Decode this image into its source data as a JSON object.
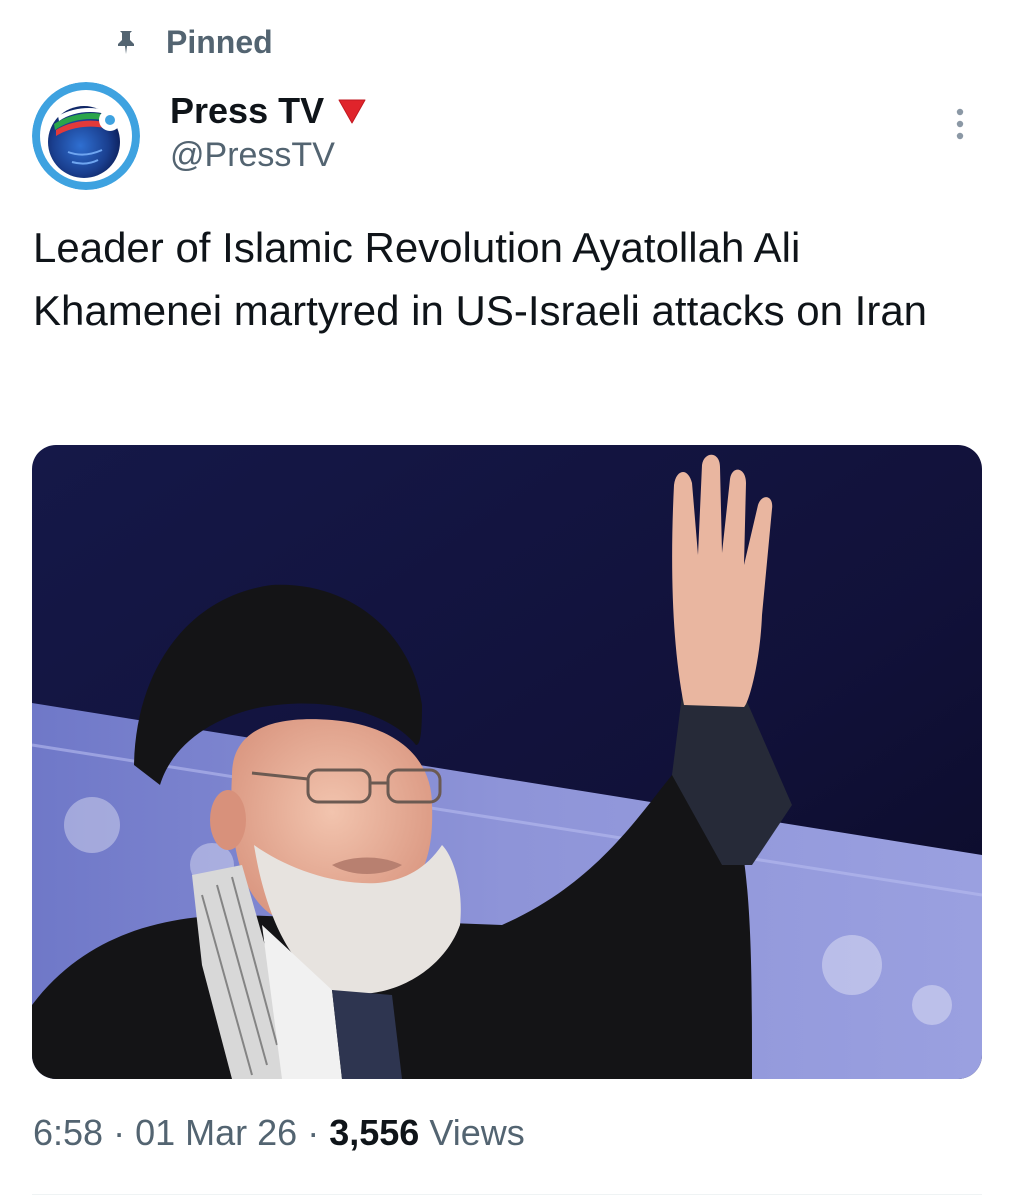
{
  "pinned": {
    "label": "Pinned",
    "icon": "pin-icon"
  },
  "author": {
    "display_name": "Press TV",
    "handle": "@PressTV",
    "badge_icon": "red-triangle-icon",
    "avatar_icon": "press-tv-logo"
  },
  "more_menu": {
    "icon": "more-vertical-icon"
  },
  "tweet": {
    "text": "Leader of Islamic Revolution Ayatollah Ali Khamenei martyred in US-Israeli attacks on Iran"
  },
  "media": {
    "description_icon": "photo"
  },
  "meta": {
    "time": "6:58",
    "separator": "·",
    "date": "01 Mar 26",
    "views_count": "3,556",
    "views_label": "Views"
  },
  "colors": {
    "text_primary": "#0f1419",
    "text_secondary": "#536471",
    "badge_red": "#e0242b",
    "divider": "#eff3f4"
  }
}
